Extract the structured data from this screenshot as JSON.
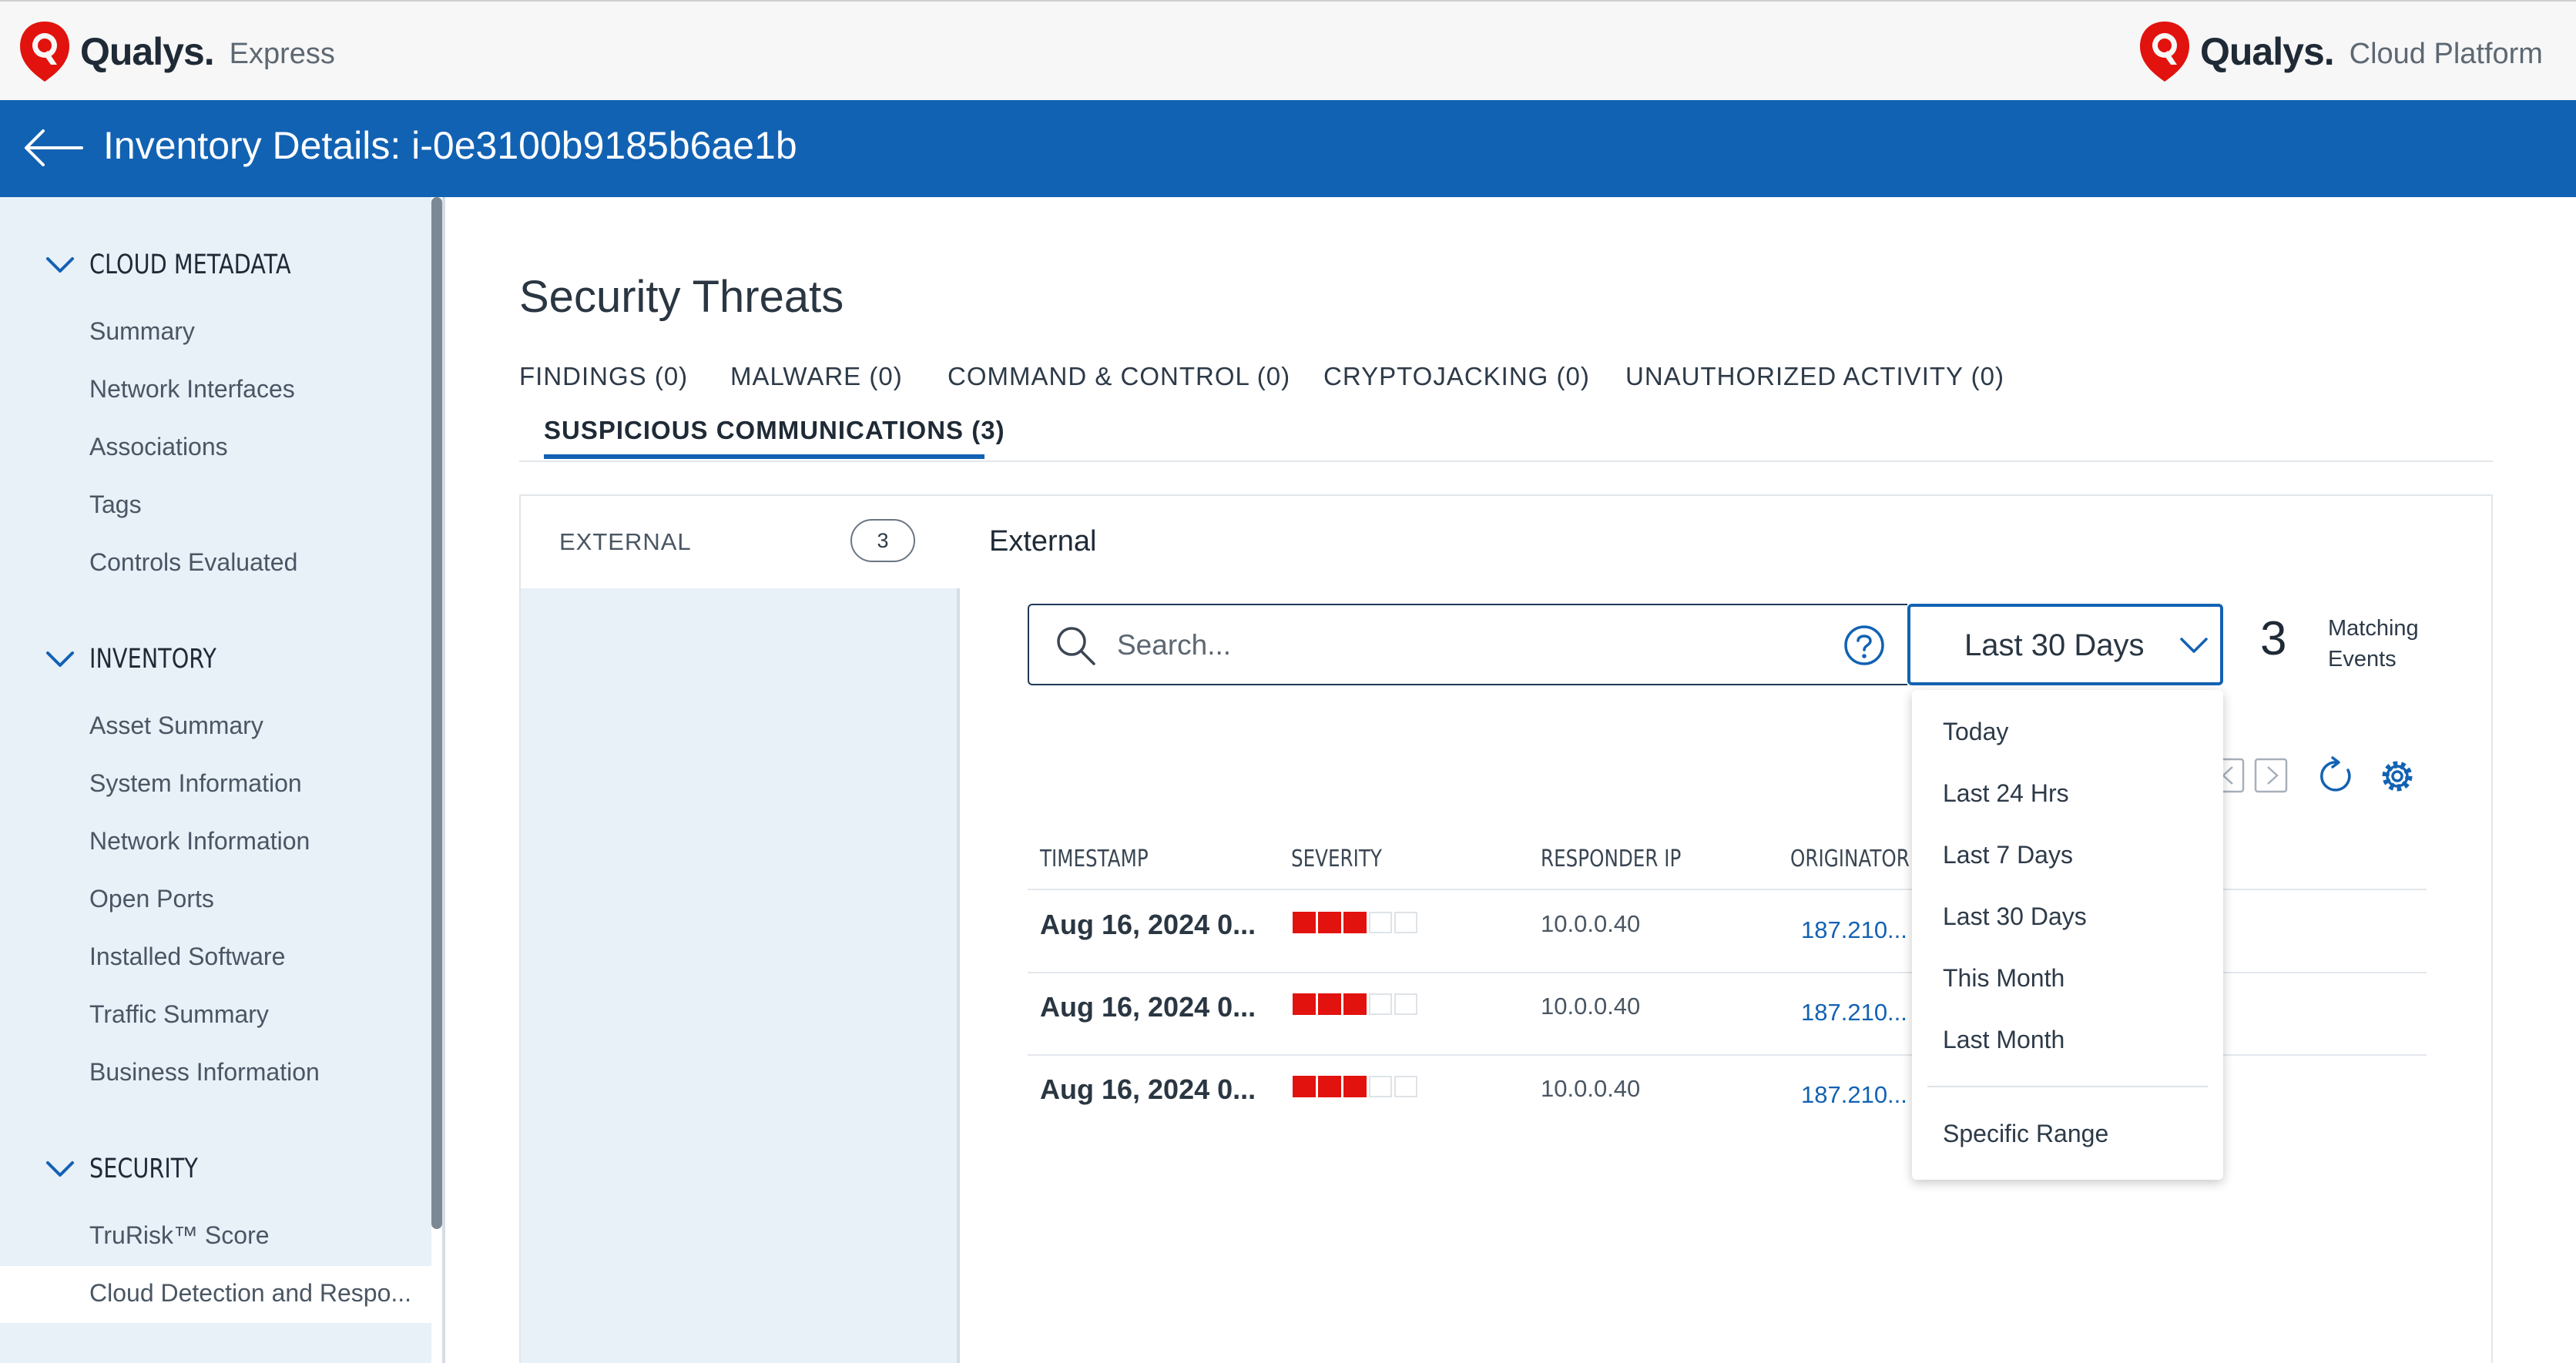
{
  "brand_left": {
    "name": "Qualys.",
    "product": "Express"
  },
  "brand_right": {
    "name": "Qualys.",
    "product": "Cloud Platform"
  },
  "page_header": {
    "title": "Inventory Details: i-0e3100b9185b6ae1b"
  },
  "sidebar": {
    "sections": [
      {
        "label": "CLOUD METADATA",
        "items": [
          "Summary",
          "Network Interfaces",
          "Associations",
          "Tags",
          "Controls Evaluated"
        ]
      },
      {
        "label": "INVENTORY",
        "items": [
          "Asset Summary",
          "System Information",
          "Network Information",
          "Open Ports",
          "Installed Software",
          "Traffic Summary",
          "Business Information"
        ]
      },
      {
        "label": "SECURITY",
        "items": [
          "TruRisk™ Score",
          "Cloud Detection and Respo..."
        ]
      }
    ]
  },
  "main": {
    "title": "Security Threats",
    "tabs": [
      {
        "label": "FINDINGS (0)"
      },
      {
        "label": "MALWARE (0)"
      },
      {
        "label": "COMMAND & CONTROL (0)"
      },
      {
        "label": "CRYPTOJACKING (0)"
      },
      {
        "label": "UNAUTHORIZED ACTIVITY (0)"
      },
      {
        "label": "SUSPICIOUS COMMUNICATIONS (3)"
      }
    ],
    "subnav": {
      "label": "EXTERNAL",
      "count": "3"
    },
    "section_title": "External",
    "search": {
      "placeholder": "Search...",
      "value": ""
    },
    "range": {
      "selected": "Last 30 Days"
    },
    "matching": {
      "count": "3",
      "label": "Matching Events"
    },
    "table": {
      "columns": [
        "TIMESTAMP",
        "SEVERITY",
        "RESPONDER IP",
        "ORIGINATOR"
      ],
      "rows": [
        {
          "timestamp": "Aug 16, 2024 0...",
          "severity": 3,
          "severity_max": 5,
          "responder_ip": "10.0.0.40",
          "originator": "187.210..."
        },
        {
          "timestamp": "Aug 16, 2024 0...",
          "severity": 3,
          "severity_max": 5,
          "responder_ip": "10.0.0.40",
          "originator": "187.210..."
        },
        {
          "timestamp": "Aug 16, 2024 0...",
          "severity": 3,
          "severity_max": 5,
          "responder_ip": "10.0.0.40",
          "originator": "187.210..."
        }
      ]
    },
    "range_menu": {
      "options": [
        "Today",
        "Last 24 Hrs",
        "Last 7 Days",
        "Last 30 Days",
        "This Month",
        "Last Month"
      ],
      "extra_option": "Specific Range"
    }
  },
  "colors": {
    "brand_red": "#e2120e",
    "header_blue": "#1262b3",
    "sidebar_bg": "#e8f0f8",
    "link_blue": "#1262b3"
  },
  "icons": [
    "qualys-logo-icon",
    "back-arrow-icon",
    "chevron-down-icon",
    "search-icon",
    "help-icon",
    "prev-page-icon",
    "next-page-icon",
    "refresh-icon",
    "settings-gear-icon"
  ]
}
